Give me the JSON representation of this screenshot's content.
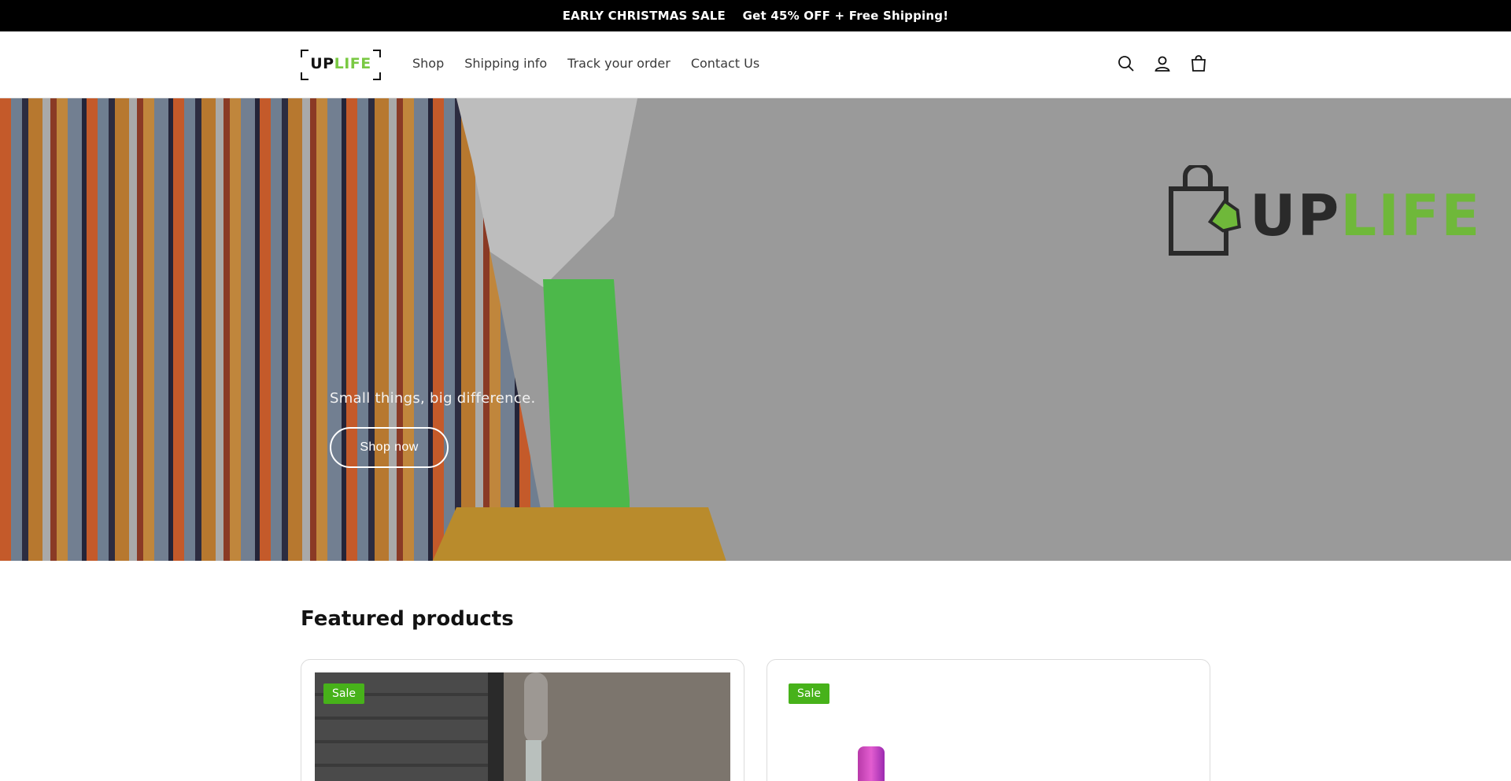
{
  "announcement": {
    "text": "EARLY CHRISTMAS SALE    Get 45% OFF + Free Shipping!"
  },
  "header": {
    "logo": {
      "up": "UP",
      "life": "LIFE"
    },
    "nav": [
      {
        "label": "Shop"
      },
      {
        "label": "Shipping info"
      },
      {
        "label": "Track your order"
      },
      {
        "label": "Contact Us"
      }
    ],
    "icons": [
      "search-icon",
      "account-icon",
      "cart-icon"
    ]
  },
  "hero": {
    "logo": {
      "up": "UP",
      "life": "LIFE"
    },
    "tagline": "Small things, big difference.",
    "cta_label": "Shop now"
  },
  "featured": {
    "title": "Featured products",
    "products": [
      {
        "badge": "Sale"
      },
      {
        "badge": "Sale"
      }
    ]
  },
  "colors": {
    "accent_green": "#47b21a",
    "logo_green": "#7ac943",
    "announce_bg": "#000000"
  }
}
